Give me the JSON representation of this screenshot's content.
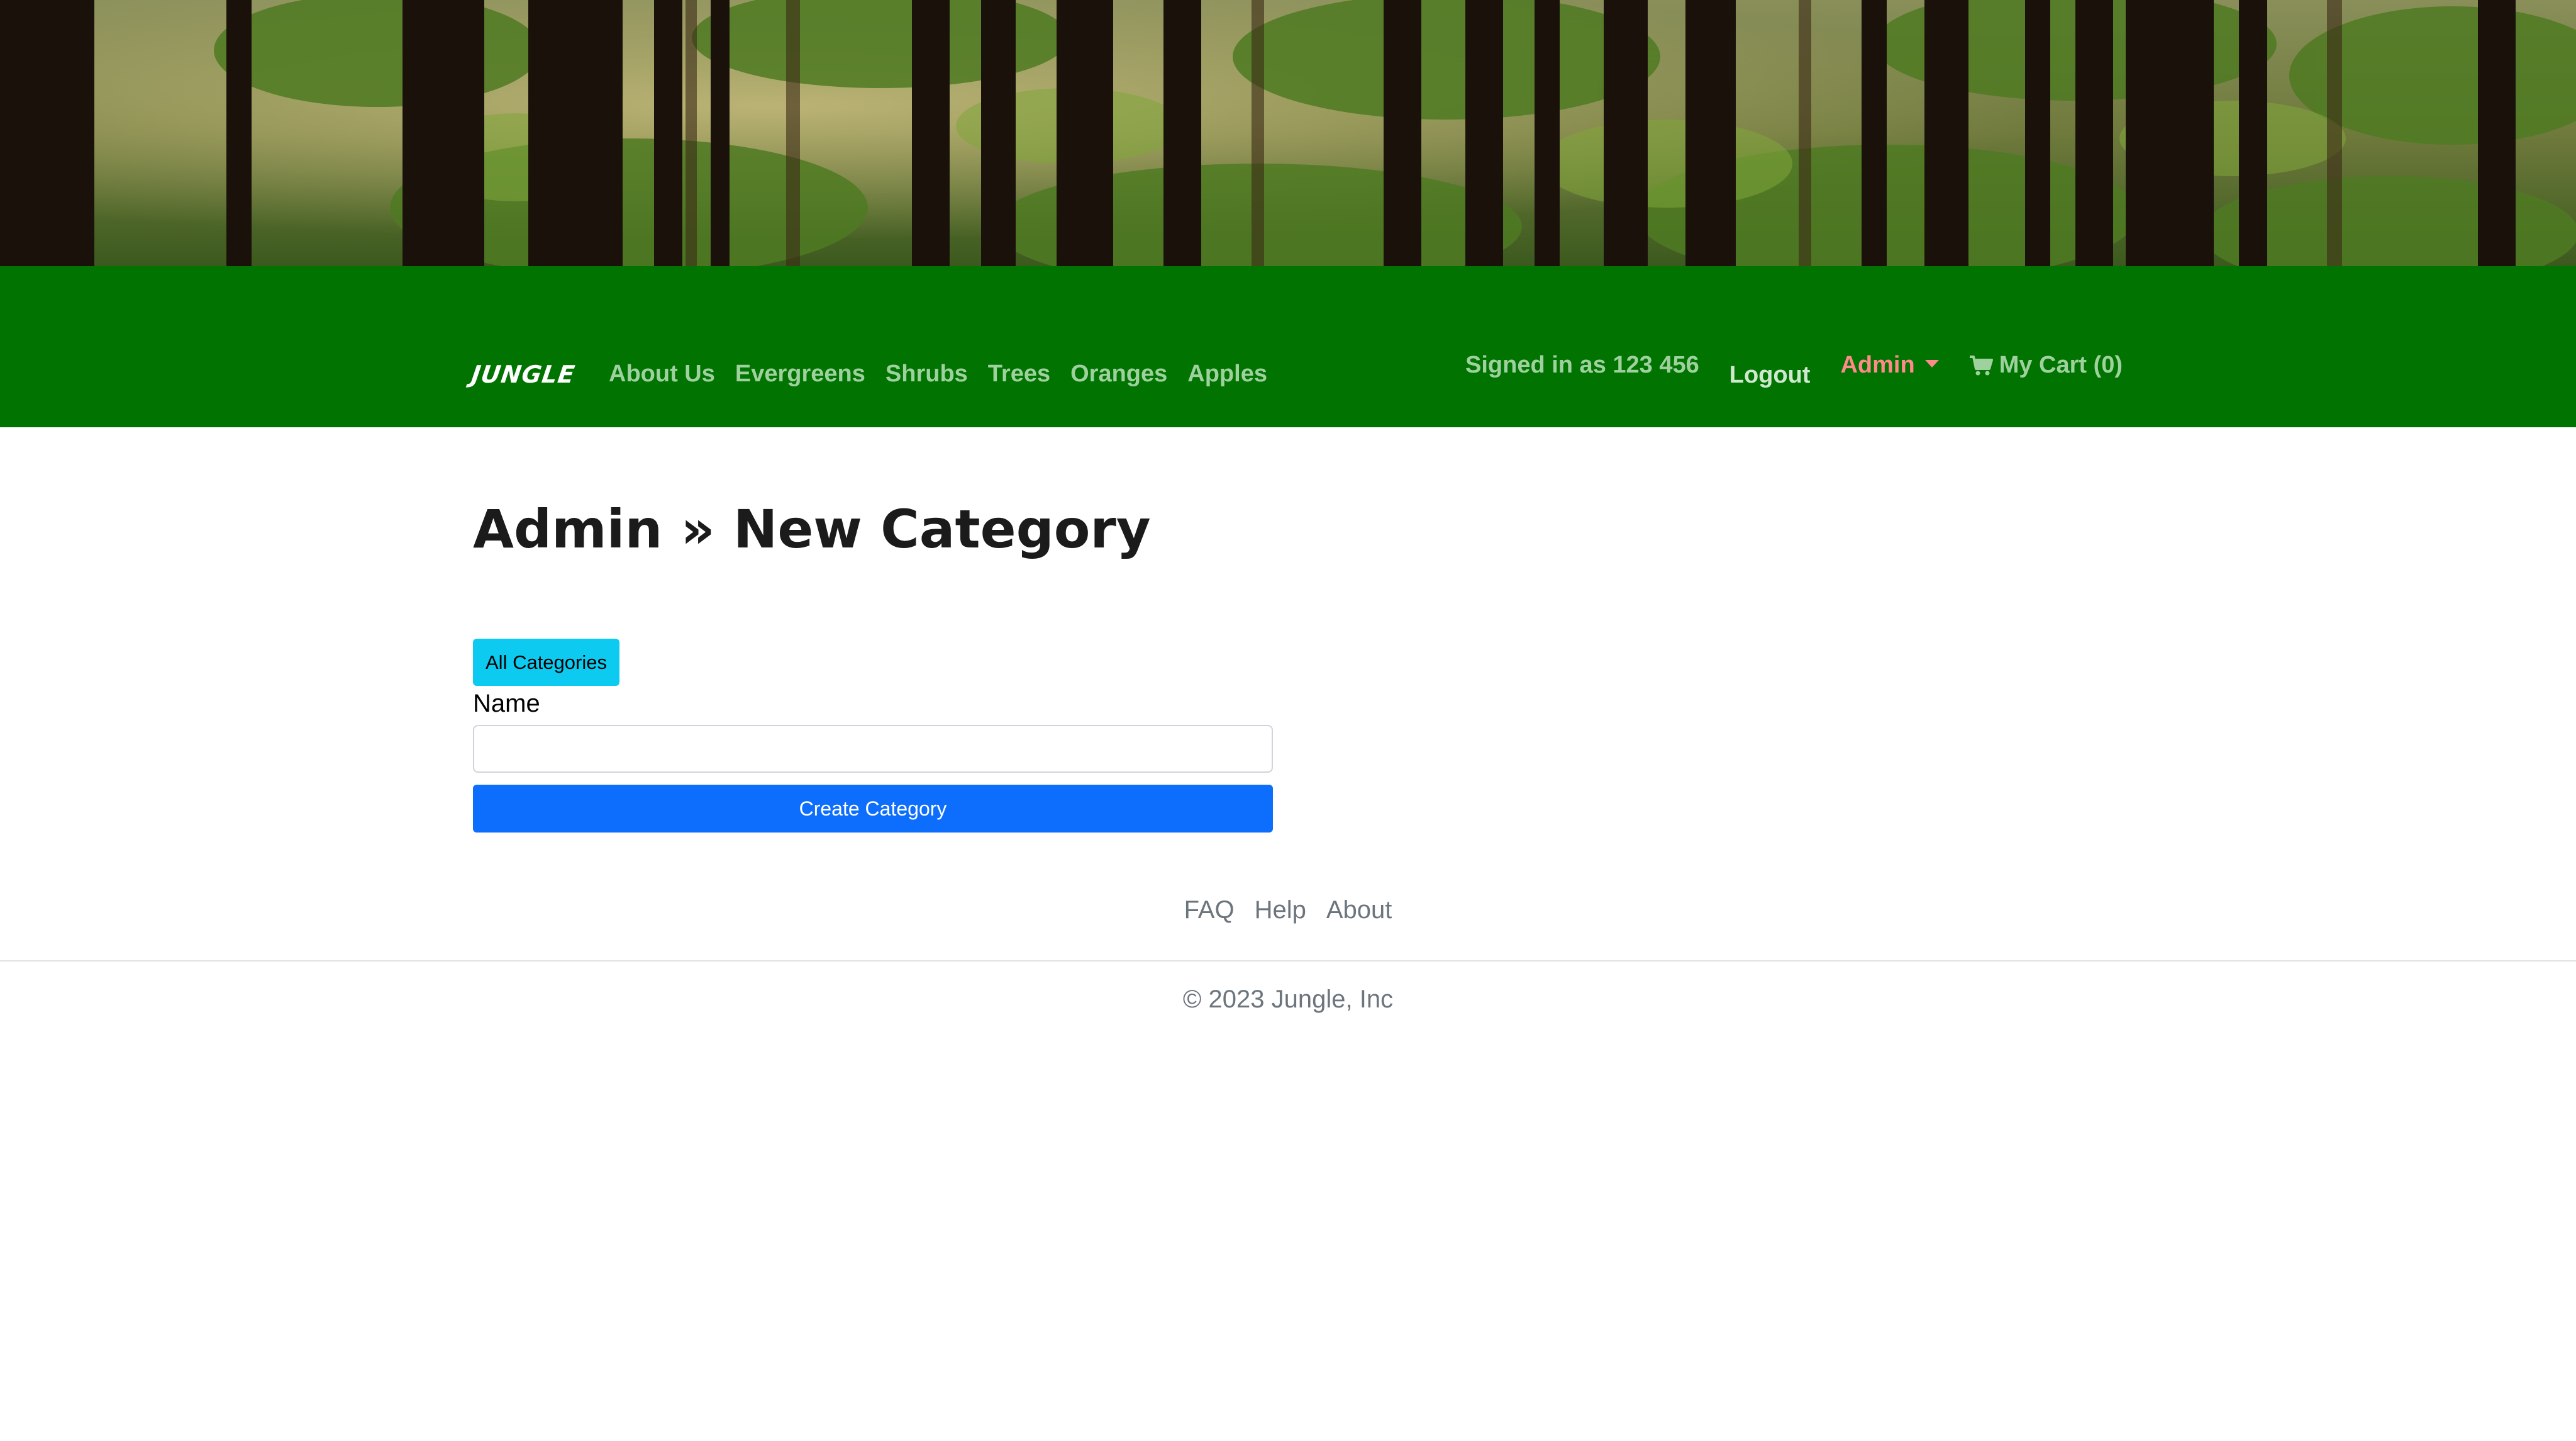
{
  "navbar": {
    "brand": "JUNGLE",
    "links": [
      "About Us",
      "Evergreens",
      "Shrubs",
      "Trees",
      "Oranges",
      "Apples"
    ],
    "signed_in": "Signed in as 123 456",
    "logout": "Logout",
    "admin": "Admin",
    "cart": "My Cart (0)"
  },
  "main": {
    "title": "Admin » New Category",
    "all_categories_button": "All Categories",
    "name_label": "Name",
    "name_value": "",
    "create_button": "Create Category"
  },
  "footer": {
    "links": [
      "FAQ",
      "Help",
      "About"
    ],
    "copyright": "© 2023 Jungle, Inc"
  },
  "colors": {
    "navbar_bg": "#007300",
    "nav_link": "#9fd19f",
    "admin_link": "#ff8a8a",
    "all_categories_bg": "#0dcaf0",
    "create_bg": "#0d6efd"
  },
  "icons": {
    "cart": "shopping-cart-icon",
    "admin_caret": "caret-down-icon"
  }
}
